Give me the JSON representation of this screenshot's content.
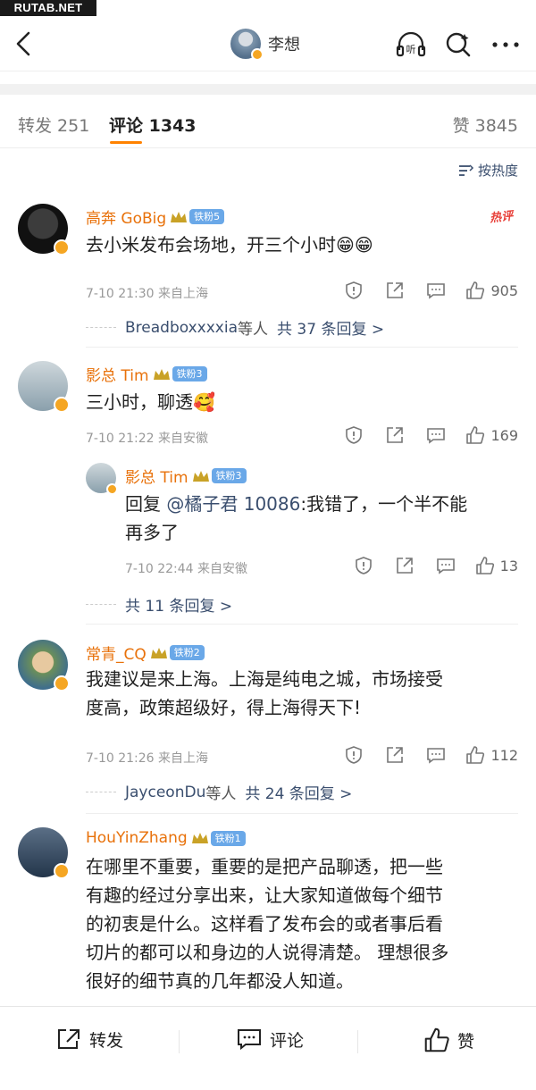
{
  "watermark": "RUTAB.NET",
  "nav": {
    "profile_name": "李想"
  },
  "tabs": {
    "repost": "转发 251",
    "comment": "评论 1343",
    "like": "赞 3845"
  },
  "sort_label": "按热度",
  "comments": [
    {
      "name": "高奔 GoBig",
      "fan": "铁粉5",
      "hot": "热评",
      "text": "去小米发布会场地，开三个小时😁😁",
      "meta": "7-10 21:30 来自上海",
      "likes": "905",
      "replies_user": "Breadboxxxxia",
      "replies_mid": "等人",
      "replies_count": "共 37 条回复 >"
    },
    {
      "name": "影总 Tim",
      "fan": "铁粉3",
      "text": "三小时，聊透🥰",
      "meta": "7-10 21:22 来自安徽",
      "likes": "169",
      "reply": {
        "name": "影总 Tim",
        "fan": "铁粉3",
        "prefix": "回复 ",
        "mention": "@橘子君 10086",
        "text_line1": ":我错了，一个半不能",
        "text_line2": "再多了",
        "meta": "7-10 22:44 来自安徽",
        "likes": "13"
      },
      "replies_count": "共 11 条回复 >"
    },
    {
      "name": "常青_CQ",
      "fan": "铁粉2",
      "text_line1": "我建议是来上海。上海是纯电之城，市场接受",
      "text_line2": "度高，政策超级好，得上海得天下!",
      "meta": "7-10 21:26 来自上海",
      "likes": "112",
      "replies_user": "JayceonDu",
      "replies_mid": "等人",
      "replies_count": "共 24 条回复 >"
    },
    {
      "name": "HouYinZhang",
      "fan": "铁粉1",
      "text_line1": "在哪里不重要，重要的是把产品聊透，把一些",
      "text_line2": "有趣的经过分享出来，让大家知道做每个细节",
      "text_line3": "的初衷是什么。这样看了发布会的或者事后看",
      "text_line4": "切片的都可以和身边的人说得清楚。 理想很多",
      "text_line5": "很好的细节真的几年都没人知道。"
    }
  ],
  "bottom": {
    "repost": "转发",
    "comment": "评论",
    "like": "赞"
  },
  "colors": {
    "accent": "#ff8200",
    "name": "#e8710a",
    "link": "#3a4e6e",
    "fan_badge": "#6aa8e8"
  }
}
